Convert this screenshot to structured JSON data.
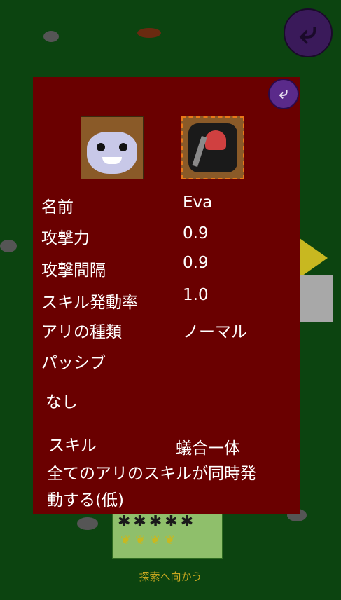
{
  "background": {
    "back_icon": "back-arrow-icon"
  },
  "bottom": {
    "explore_label": "探索へ向かう"
  },
  "dialog": {
    "close_icon": "back-arrow-icon",
    "portrait_icon": "ant-face-icon",
    "weapon_icon": "axe-icon",
    "stats": [
      {
        "label": "名前",
        "value": "Eva"
      },
      {
        "label": "攻撃力",
        "value": "0.9"
      },
      {
        "label": "攻撃間隔",
        "value": "0.9"
      },
      {
        "label": "スキル発動率",
        "value": "1.0"
      },
      {
        "label": "アリの種類",
        "value": "ノーマル"
      }
    ],
    "passive_label": "パッシブ",
    "passive_value": "なし",
    "skill_label": "スキル",
    "skill_name": "蟻合一体",
    "skill_desc_line1": "全てのアリのスキルが同時発",
    "skill_desc_line2": "動する(低)"
  },
  "colors": {
    "background": "#0c4410",
    "panel": "#6a0000",
    "accent_text": "#c8a820"
  }
}
